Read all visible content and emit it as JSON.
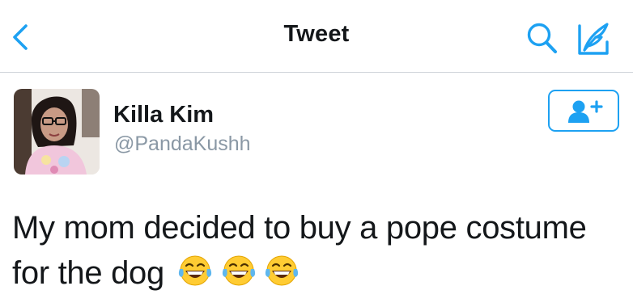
{
  "navbar": {
    "title": "Tweet",
    "back_icon": "chevron-left-icon",
    "search_icon": "search-icon",
    "compose_icon": "compose-quill-icon"
  },
  "tweet": {
    "author_name": "Killa Kim",
    "author_handle": "@PandaKushh",
    "text_line1": "My mom decided to buy a pope costume",
    "text_line2": "for the dog",
    "emoji": [
      "face-with-tears-of-joy",
      "face-with-tears-of-joy",
      "face-with-tears-of-joy"
    ]
  },
  "follow_button": {
    "icon": "add-user-icon"
  },
  "colors": {
    "accent": "#1da1f2",
    "text": "#14171a",
    "secondary_text": "#8a98a5",
    "divider": "#cfd4d9"
  }
}
